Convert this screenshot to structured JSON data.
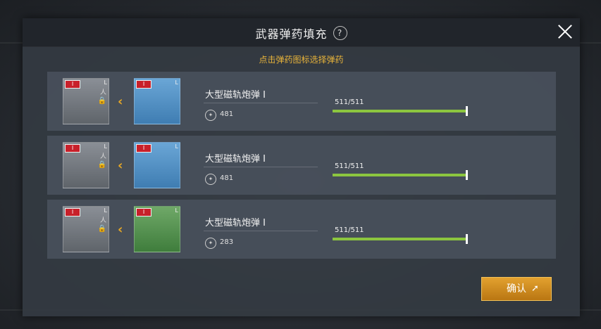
{
  "dialog": {
    "title": "武器弹药填充",
    "help_label": "?",
    "hint": "点击弹药图标选择弹药",
    "confirm_label": "确认"
  },
  "rows": [
    {
      "weapon_tier": "I",
      "weapon_size": "L",
      "ammo_tier": "I",
      "ammo_size": "L",
      "ammo_color": "blue",
      "ammo_name": "大型磁轨炮弹 I",
      "ammo_count": "481",
      "capacity_text": "511/511",
      "fill_fraction": 1.0
    },
    {
      "weapon_tier": "I",
      "weapon_size": "L",
      "ammo_tier": "I",
      "ammo_size": "L",
      "ammo_color": "blue",
      "ammo_name": "大型磁轨炮弹 I",
      "ammo_count": "481",
      "capacity_text": "511/511",
      "fill_fraction": 1.0
    },
    {
      "weapon_tier": "I",
      "weapon_size": "L",
      "ammo_tier": "I",
      "ammo_size": "L",
      "ammo_color": "green",
      "ammo_name": "大型磁轨炮弹 I",
      "ammo_count": "283",
      "capacity_text": "511/511",
      "fill_fraction": 1.0
    }
  ],
  "colors": {
    "accent": "#e8b43a",
    "bar": "#8cc63f",
    "button": "#d99527"
  },
  "icons": {
    "arrow": "chevron-left-icon",
    "lock": "lock-icon",
    "close": "close-icon",
    "ammo_count": "ammo-count-icon"
  }
}
